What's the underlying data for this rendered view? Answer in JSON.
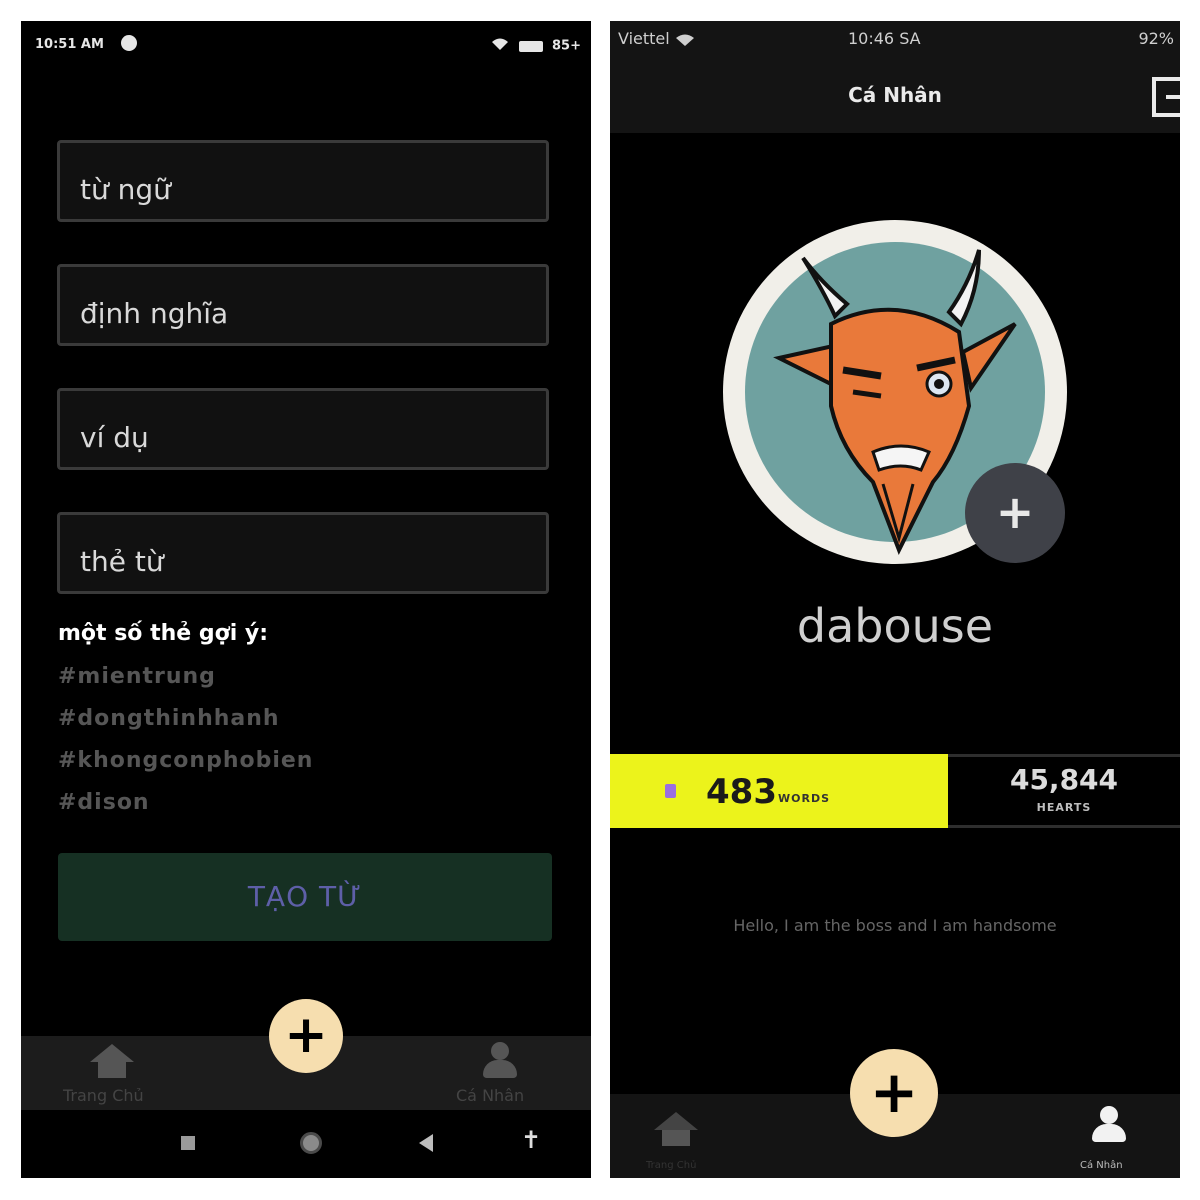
{
  "left_screen": {
    "status_bar": {
      "time": "10:51 AM",
      "battery": "85+"
    },
    "fields": [
      {
        "placeholder": "từ ngữ"
      },
      {
        "placeholder": "định nghĩa"
      },
      {
        "placeholder": "ví dụ"
      },
      {
        "placeholder": "thẻ từ"
      }
    ],
    "suggestions_title": "một số thẻ gợi ý:",
    "suggested_tags": [
      "#mientrung",
      "#dongthinhhanh",
      "#khongconphobien",
      "#dison"
    ],
    "create_button": "TẠO TỪ",
    "nav": {
      "home_label": "Trang Chủ",
      "add_label": "+",
      "profile_label": "Cá Nhân"
    },
    "system_nav": {
      "accessibility": "✝"
    }
  },
  "right_screen": {
    "status_bar": {
      "carrier": "Viettel",
      "time": "10:46 SA",
      "battery": "92%"
    },
    "header_title": "Cá Nhân",
    "avatar_add_label": "+",
    "username": "dabouse",
    "stats": {
      "words_count": "483",
      "words_label": "WORDS",
      "hearts_count": "45,844",
      "hearts_label": "HEARTS"
    },
    "bio": "Hello, I am the boss and I am handsome",
    "nav": {
      "home_label": "Trang Chủ",
      "add_label": "+",
      "profile_label": "Cá Nhân"
    }
  },
  "colors": {
    "background": "#000000",
    "fab": "#f6deaf",
    "create_button": "#163023",
    "words_highlight": "#ecf31b"
  }
}
